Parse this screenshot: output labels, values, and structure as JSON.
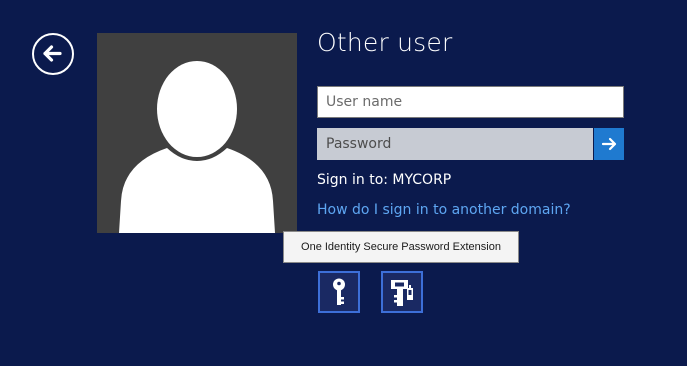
{
  "screen": {
    "title": "Other user",
    "background_color": "#0b1a4d"
  },
  "back_button": {
    "icon": "back-arrow-icon"
  },
  "avatar": {
    "icon": "generic-user-silhouette"
  },
  "username_field": {
    "placeholder": "User name",
    "value": ""
  },
  "password_field": {
    "placeholder": "Password",
    "value": ""
  },
  "submit_button": {
    "icon": "right-arrow-icon",
    "color": "#1f7ad0"
  },
  "sign_in_to": "Sign in to: MYCORP",
  "domain_link": "How do I sign in to another domain?",
  "tooltip": "One Identity Secure Password Extension",
  "credential_providers": [
    {
      "icon": "key-icon"
    },
    {
      "icon": "secure-password-extension-icon"
    }
  ]
}
